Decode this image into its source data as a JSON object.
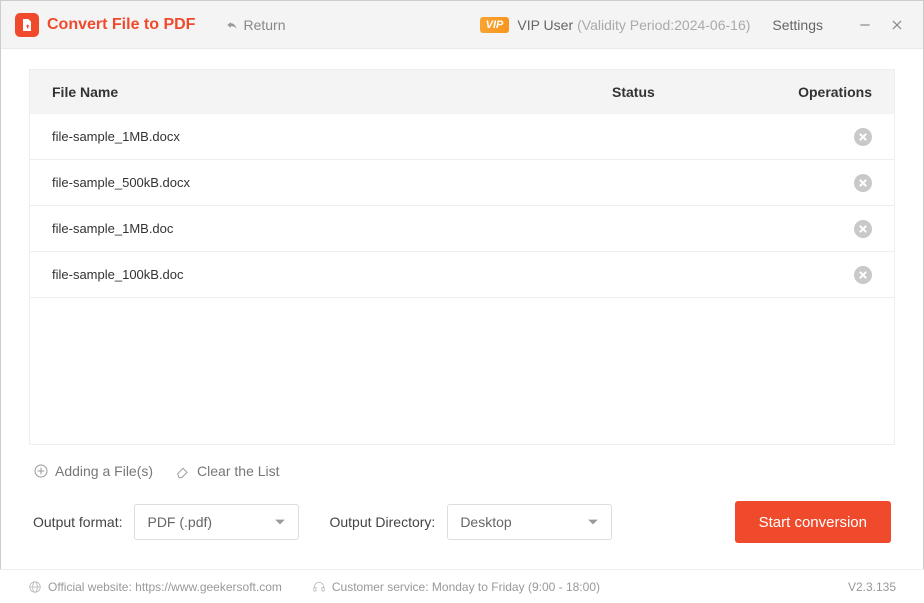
{
  "header": {
    "title": "Convert File to PDF",
    "return_label": "Return",
    "vip_badge": "VIP",
    "vip_user": "VIP User",
    "validity": "(Validity Period:2024-06-16)",
    "settings": "Settings"
  },
  "table": {
    "col_name": "File Name",
    "col_status": "Status",
    "col_ops": "Operations",
    "rows": [
      {
        "name": "file-sample_1MB.docx"
      },
      {
        "name": "file-sample_500kB.docx"
      },
      {
        "name": "file-sample_1MB.doc"
      },
      {
        "name": "file-sample_100kB.doc"
      }
    ]
  },
  "actions": {
    "add_file": "Adding a File(s)",
    "clear_list": "Clear the List"
  },
  "controls": {
    "format_label": "Output format:",
    "format_value": "PDF (.pdf)",
    "directory_label": "Output Directory:",
    "directory_value": "Desktop",
    "start_label": "Start conversion"
  },
  "status": {
    "website_label": "Official website: https://www.geekersoft.com",
    "service_label": "Customer service: Monday to Friday (9:00 - 18:00)",
    "version": "V2.3.135"
  }
}
